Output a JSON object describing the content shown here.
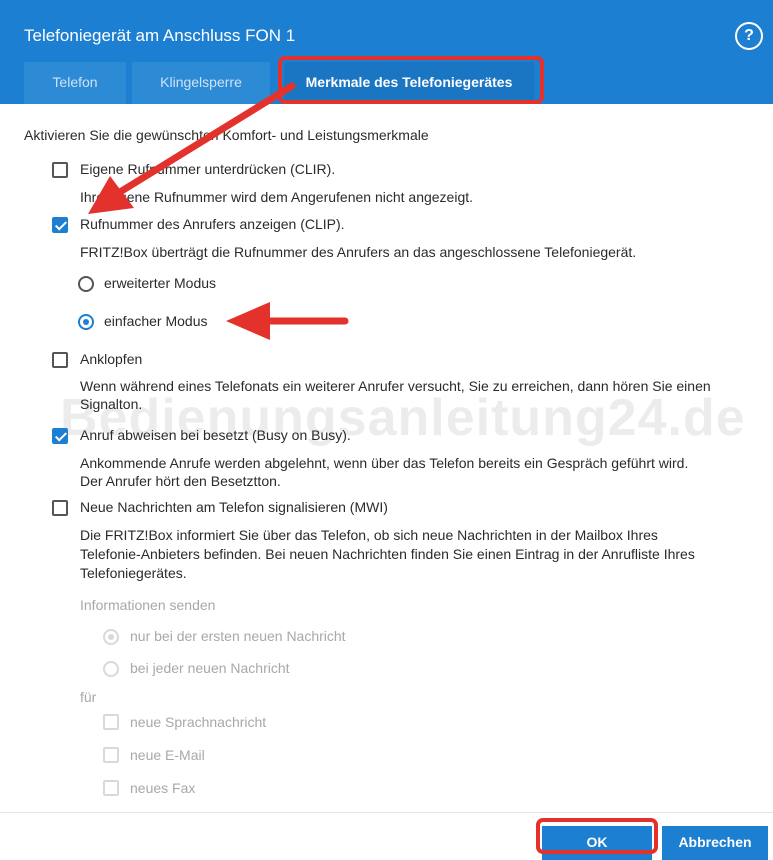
{
  "dialog": {
    "title": "Telefoniegerät am Anschluss FON 1",
    "help_glyph": "?"
  },
  "tabs": [
    {
      "label": "Telefon",
      "active": false
    },
    {
      "label": "Klingelsperre",
      "active": false
    },
    {
      "label": "Merkmale des Telefoniegerätes",
      "active": true
    }
  ],
  "intro": "Aktivieren Sie die gewünschten Komfort- und Leistungsmerkmale",
  "features": {
    "clir": {
      "label": "Eigene Rufnummer unterdrücken (CLIR).",
      "checked": false,
      "desc": "Ihre eigene Rufnummer wird dem Angerufenen nicht angezeigt."
    },
    "clip": {
      "label": "Rufnummer des Anrufers anzeigen (CLIP).",
      "checked": true,
      "desc": "FRITZ!Box überträgt die Rufnummer des Anrufers an das angeschlossene Telefoniegerät.",
      "mode_extended": "erweiterter Modus",
      "mode_simple": "einfacher Modus",
      "selected_mode": "einfacher Modus"
    },
    "anklopfen": {
      "label": "Anklopfen",
      "checked": false,
      "desc_line1": "Wenn während eines Telefonats ein weiterer Anrufer versucht, Sie zu erreichen, dann hören Sie einen",
      "desc_line2": "Signalton."
    },
    "busy": {
      "label": "Anruf abweisen bei besetzt (Busy on Busy).",
      "checked": true,
      "desc_line1": "Ankommende Anrufe werden abgelehnt, wenn über das Telefon bereits ein Gespräch geführt wird.",
      "desc_line2": "Der Anrufer hört den Besetztton."
    },
    "mwi": {
      "label": "Neue Nachrichten am Telefon signalisieren (MWI)",
      "checked": false,
      "desc_line1": "Die FRITZ!Box informiert Sie über das Telefon, ob sich neue Nachrichten in der Mailbox Ihres",
      "desc_line2": "Telefonie-Anbieters befinden. Bei neuen Nachrichten finden Sie einen Eintrag in der Anrufliste Ihres",
      "desc_line3": "Telefoniegerätes.",
      "info_heading": "Informationen senden",
      "opt_first": "nur bei der ersten neuen Nachricht",
      "opt_every": "bei jeder neuen Nachricht",
      "for_label": "für",
      "for_voice": "neue Sprachnachricht",
      "for_email": "neue E-Mail",
      "for_fax": "neues Fax"
    }
  },
  "watermark": "Bedienungsanleitung24.de",
  "buttons": {
    "ok": "OK",
    "cancel": "Abbrechen"
  },
  "colors": {
    "header_blue": "#1c7fd1",
    "annotation_red": "#e3322c"
  }
}
